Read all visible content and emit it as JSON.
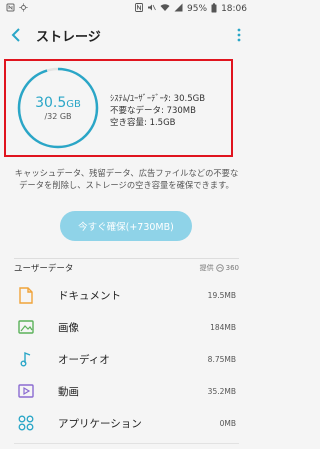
{
  "status_bar": {
    "battery": "95%",
    "time": "18:06"
  },
  "header": {
    "title": "ストレージ"
  },
  "gauge": {
    "used": "30.5",
    "used_unit": "GB",
    "total": "/32 GB",
    "fraction": 0.953
  },
  "info": {
    "system": "ｼｽﾃﾑ/ﾕｰｻﾞｰﾃﾞｰﾀ: 30.5GB",
    "unneeded": "不要なデータ: 730MB",
    "free": "空き容量: 1.5GB"
  },
  "note": "キャッシュデータ、残留データ、広告ファイルなどの不要なデータを削除し、ストレージの空き容量を確保できます。",
  "cta": {
    "label": "今すぐ確保(+730MB)"
  },
  "section": {
    "title": "ユーザーデータ",
    "powered_label": "提供",
    "powered_brand": "360"
  },
  "rows": [
    {
      "label": "ドキュメント",
      "size": "19.5MB"
    },
    {
      "label": "画像",
      "size": "184MB"
    },
    {
      "label": "オーディオ",
      "size": "8.75MB"
    },
    {
      "label": "動画",
      "size": "35.2MB"
    },
    {
      "label": "アプリケーション",
      "size": "0MB"
    }
  ],
  "colors": {
    "accent": "#2aa6c7",
    "cta": "#8fd3e8",
    "highlight": "#e0141e"
  }
}
